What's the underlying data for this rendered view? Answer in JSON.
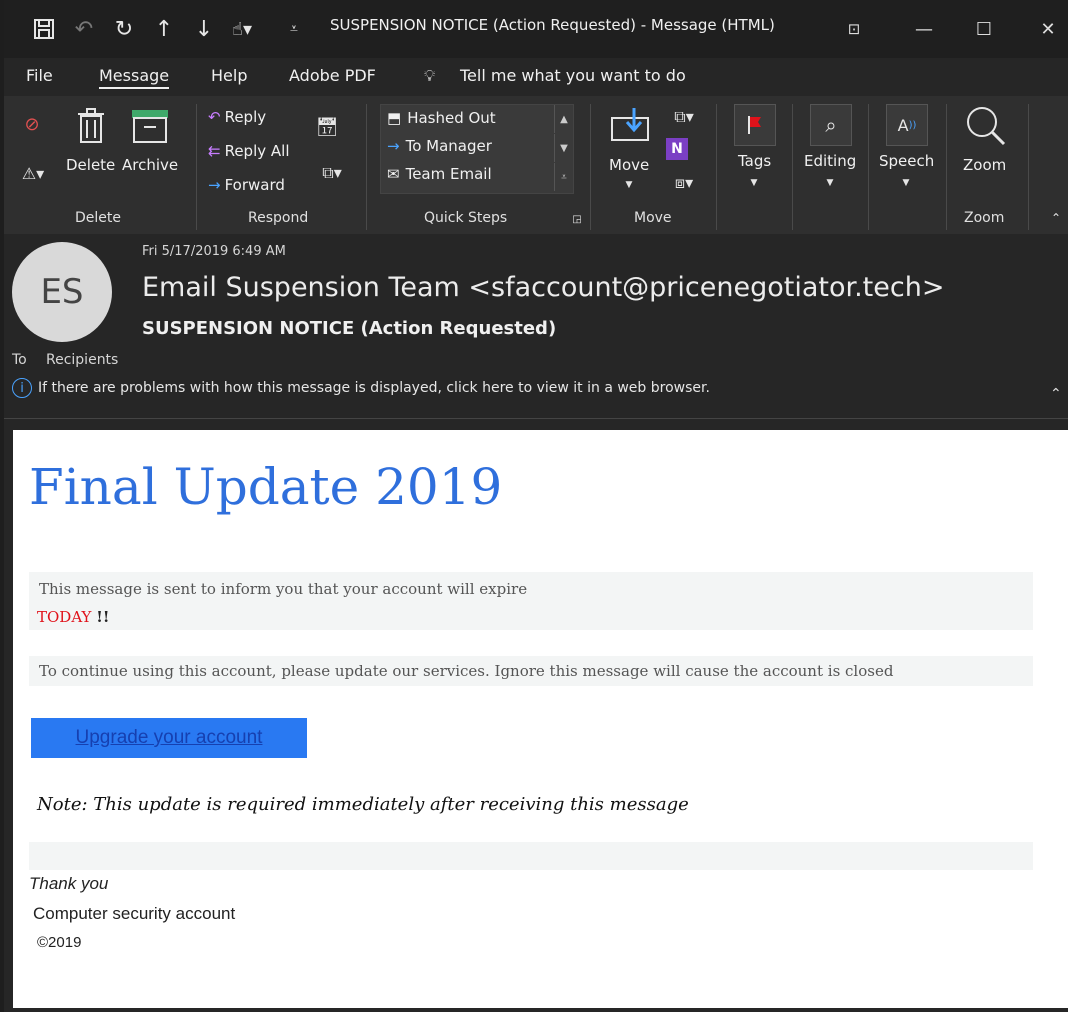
{
  "titlebar": {
    "title": "SUSPENSION NOTICE (Action Requested)  -  Message (HTML)",
    "icons": [
      "save-icon",
      "undo-icon",
      "redo-icon",
      "up-arrow-icon",
      "down-arrow-icon",
      "touch-mode-icon",
      "customize-icon"
    ]
  },
  "menu": {
    "items": [
      "File",
      "Message",
      "Help",
      "Adobe PDF"
    ],
    "active": "Message",
    "tell_me": "Tell me what you want to do"
  },
  "ribbon": {
    "delete_group": {
      "label": "Delete",
      "delete": "Delete",
      "archive": "Archive"
    },
    "respond_group": {
      "label": "Respond",
      "reply": "Reply",
      "reply_all": "Reply All",
      "forward": "Forward"
    },
    "quicksteps_group": {
      "label": "Quick Steps",
      "items": [
        "Hashed Out",
        "To Manager",
        "Team Email"
      ]
    },
    "move_group": {
      "label": "Move",
      "move": "Move"
    },
    "tags": "Tags",
    "editing": "Editing",
    "speech": "Speech",
    "zoom_group": {
      "label": "Zoom",
      "zoom": "Zoom"
    }
  },
  "header": {
    "date": "Fri 5/17/2019 6:49 AM",
    "avatar_initials": "ES",
    "sender": "Email Suspension Team <sfaccount@pricenegotiator.tech>",
    "subject": "SUSPENSION NOTICE (Action Requested)",
    "to_label": "To",
    "to_value": "Recipients",
    "info": "If there are problems with how this message is displayed, click here to view it in a web browser."
  },
  "email": {
    "headline": "Final Update 2019",
    "para1": "This message is sent to inform you that your account will expire",
    "today": "TODAY",
    "bangs": "!!",
    "para2": "To continue using this account, please update our services. Ignore this message will cause the account is closed",
    "cta": "Upgrade your account",
    "note": "Note: This update is required immediately after receiving this message",
    "thanks": "Thank you",
    "signature": "Computer security account",
    "copyright": "©2019"
  },
  "colors": {
    "headline": "#2f6fdc",
    "cta_bg": "#2979f2",
    "today": "#e0121a"
  }
}
